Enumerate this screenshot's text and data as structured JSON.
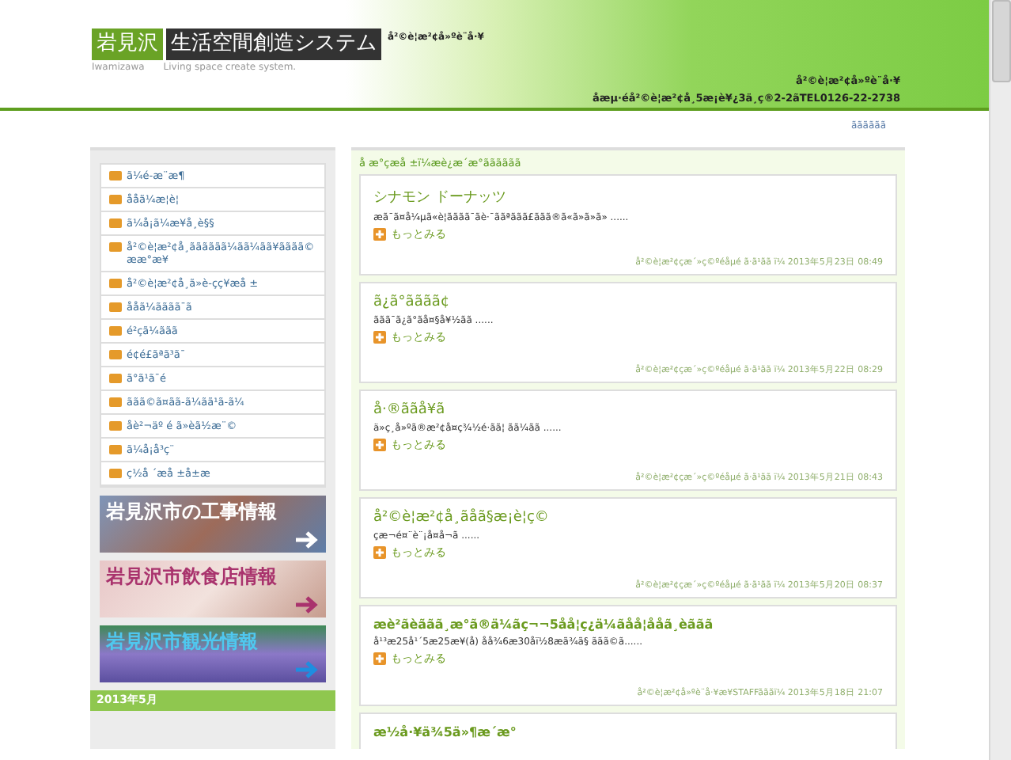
{
  "header": {
    "logo_city": "岩見沢",
    "logo_title": "生活空間創造システム",
    "logo_city_roman": "Iwamizawa",
    "logo_tagline": "Living space create system.",
    "tagline": "å²©è¦æ²¢å»ºè¨­å·¥",
    "company": "å²©è¦æ²¢å»ºè¨­å·¥",
    "address": "åæµ·éå²©è¦æ²¢å¸5æ¡è¥¿3ä¸ç®2-2ãTEL0126-22-2738"
  },
  "breadcrumb": "ãããããã",
  "sidebar": {
    "items": [
      {
        "label": "ã¼é-æ¨æ¶"
      },
      {
        "label": "ååã¼æ¦è¦"
      },
      {
        "label": "ã¼å¡ã¼æ¥­å¸è§§"
      },
      {
        "label": "å²©è¦æ²¢å¸ãããããã¼ãã¼ãã¥ãããã©ææ°æ¥"
      },
      {
        "label": "å²©è¦æ²¢å¸ã»è-çç¥æå ±"
      },
      {
        "label": "ååã¼ãããã¯ã"
      },
      {
        "label": "é²çã¼ããã"
      },
      {
        "label": "é¢é£ãªã³ã¯"
      },
      {
        "label": "ã°ã¹ã¯é"
      },
      {
        "label": "ããã©ã¤ãã-ã¼ãã¹ã-ã¼"
      },
      {
        "label": "åè²¬äº é ã»èã½æ¨©"
      },
      {
        "label": "ã¼å¡å³ç¨"
      },
      {
        "label": "ç½å ´æå ±å±æ"
      }
    ],
    "banners": [
      {
        "label": "岩見沢市の工事情報",
        "kind": "construction"
      },
      {
        "label": "岩見沢市飲食店情報",
        "kind": "food"
      },
      {
        "label": "岩見沢市観光情報",
        "kind": "tourism"
      }
    ],
    "calendar_title": "2013年5月"
  },
  "main": {
    "heading": "å æ°çæå ±ï¼æè¿æ´æ°ãããããã",
    "posts": [
      {
        "title": "シナモン ドーナッツ",
        "title_bold": false,
        "excerpt": "æã¯ã¤å¼µã«è¦ãããã¯ãè·¯ããªããã£ããã®ã«ã»ã»ã» ......",
        "more": "もっとみる",
        "meta": "å²©è¦æ²¢çæ´»ç©ºéåµé ã·ã¹ãã ï¼ 2013年5月23日 08:49"
      },
      {
        "title": "ã¿ã°ãããã¢",
        "title_bold": false,
        "excerpt": "ããã¯ã¿ã°ãå¤§å¥½ãã ......",
        "more": "もっとみる",
        "meta": "å²©è¦æ²¢çæ´»ç©ºéåµé ã·ã¹ãã ï¼ 2013年5月22日 08:29"
      },
      {
        "title": "å·®ããå¥ã",
        "title_bold": false,
        "excerpt": "ä»ç¸å»ºã®æ²¢å¤ç¾½é·ãã¦ ãã¼ãã ......",
        "more": "もっとみる",
        "meta": "å²©è¦æ²¢çæ´»ç©ºéåµé ã·ã¹ãã ï¼ 2013年5月21日 08:43"
      },
      {
        "title": "å²©è¦æ²¢å¸ãåã§æ¡è¦ç©",
        "title_bold": false,
        "excerpt": "çæ¬é¤¨è¨¡å¤å¬ã ......",
        "more": "もっとみる",
        "meta": "å²©è¦æ²¢çæ´»ç©ºéåµé ã·ã¹ãã ï¼ 2013年5月20日 08:37"
      },
      {
        "title": "æè²ãèããã¸æ°ã®ä¼ãç¬¬5åå¦ç¿ä¼ãåå¦ååã¸èããã",
        "title_bold": true,
        "excerpt": "å¹³æ25å¹´5æ25æ¥(å) åå¾6æ30åï½8æã¾ã§ ããã©ã......",
        "more": "もっとみる",
        "meta": "å²©è¦æ²¢å»ºè¨­å·¥æ¥­STAFFãããï¼ 2013年5月18日 21:07"
      },
      {
        "title": "æ½å·¥ä¾5ä»¶æ´æ°",
        "title_bold": true
      }
    ]
  }
}
